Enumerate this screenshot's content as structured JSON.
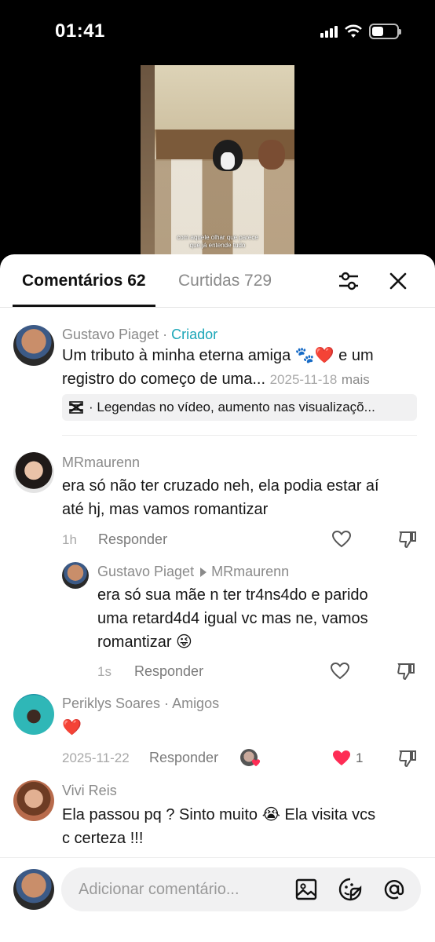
{
  "status_bar": {
    "time": "01:41",
    "battery_level": 0.45
  },
  "video": {
    "caption_line1": "com aquele olhar que parece",
    "caption_line2": "que já entende tudo"
  },
  "tabs": {
    "comments": "Comentários 62",
    "likes": "Curtidas 729"
  },
  "comments": [
    {
      "author": "Gustavo Piaget",
      "separator": " · ",
      "badge": "Criador",
      "text_line1": "Um tributo à minha eterna amiga 🐾❤️ e um",
      "text_line2": "registro do começo de uma...",
      "date": "2025-11-18",
      "more": "mais",
      "chip_text": "· Legendas no vídeo, aumento nas visualizaçõ..."
    },
    {
      "author": "MRmaurenn",
      "text_line1": "era só não ter cruzado neh, ela podia estar aí",
      "text_line2": "até hj, mas vamos romantizar",
      "time": "1h",
      "reply": "Responder",
      "replies": [
        {
          "author": "Gustavo Piaget",
          "reply_to": "MRmaurenn",
          "text_line1": "era só sua mãe n ter tr4ns4do e parido",
          "text_line2": "uma retard4d4 igual vc mas ne, vamos",
          "text_line3": "romantizar 😜",
          "time": "1s",
          "reply": "Responder"
        }
      ]
    },
    {
      "author": "Periklys Soares",
      "separator": " · ",
      "badge": "Amigos",
      "text": "❤️",
      "date": "2025-11-22",
      "reply": "Responder",
      "likes": "1"
    },
    {
      "author": "Vivi Reis",
      "text_line1": "Ela passou pq ? Sinto muito 😭 Ela visita vcs",
      "text_line2": "c certeza !!!"
    }
  ],
  "composer": {
    "placeholder": "Adicionar comentário..."
  },
  "colors": {
    "creator": "#1aa6b7",
    "liked": "#fe2c55"
  }
}
